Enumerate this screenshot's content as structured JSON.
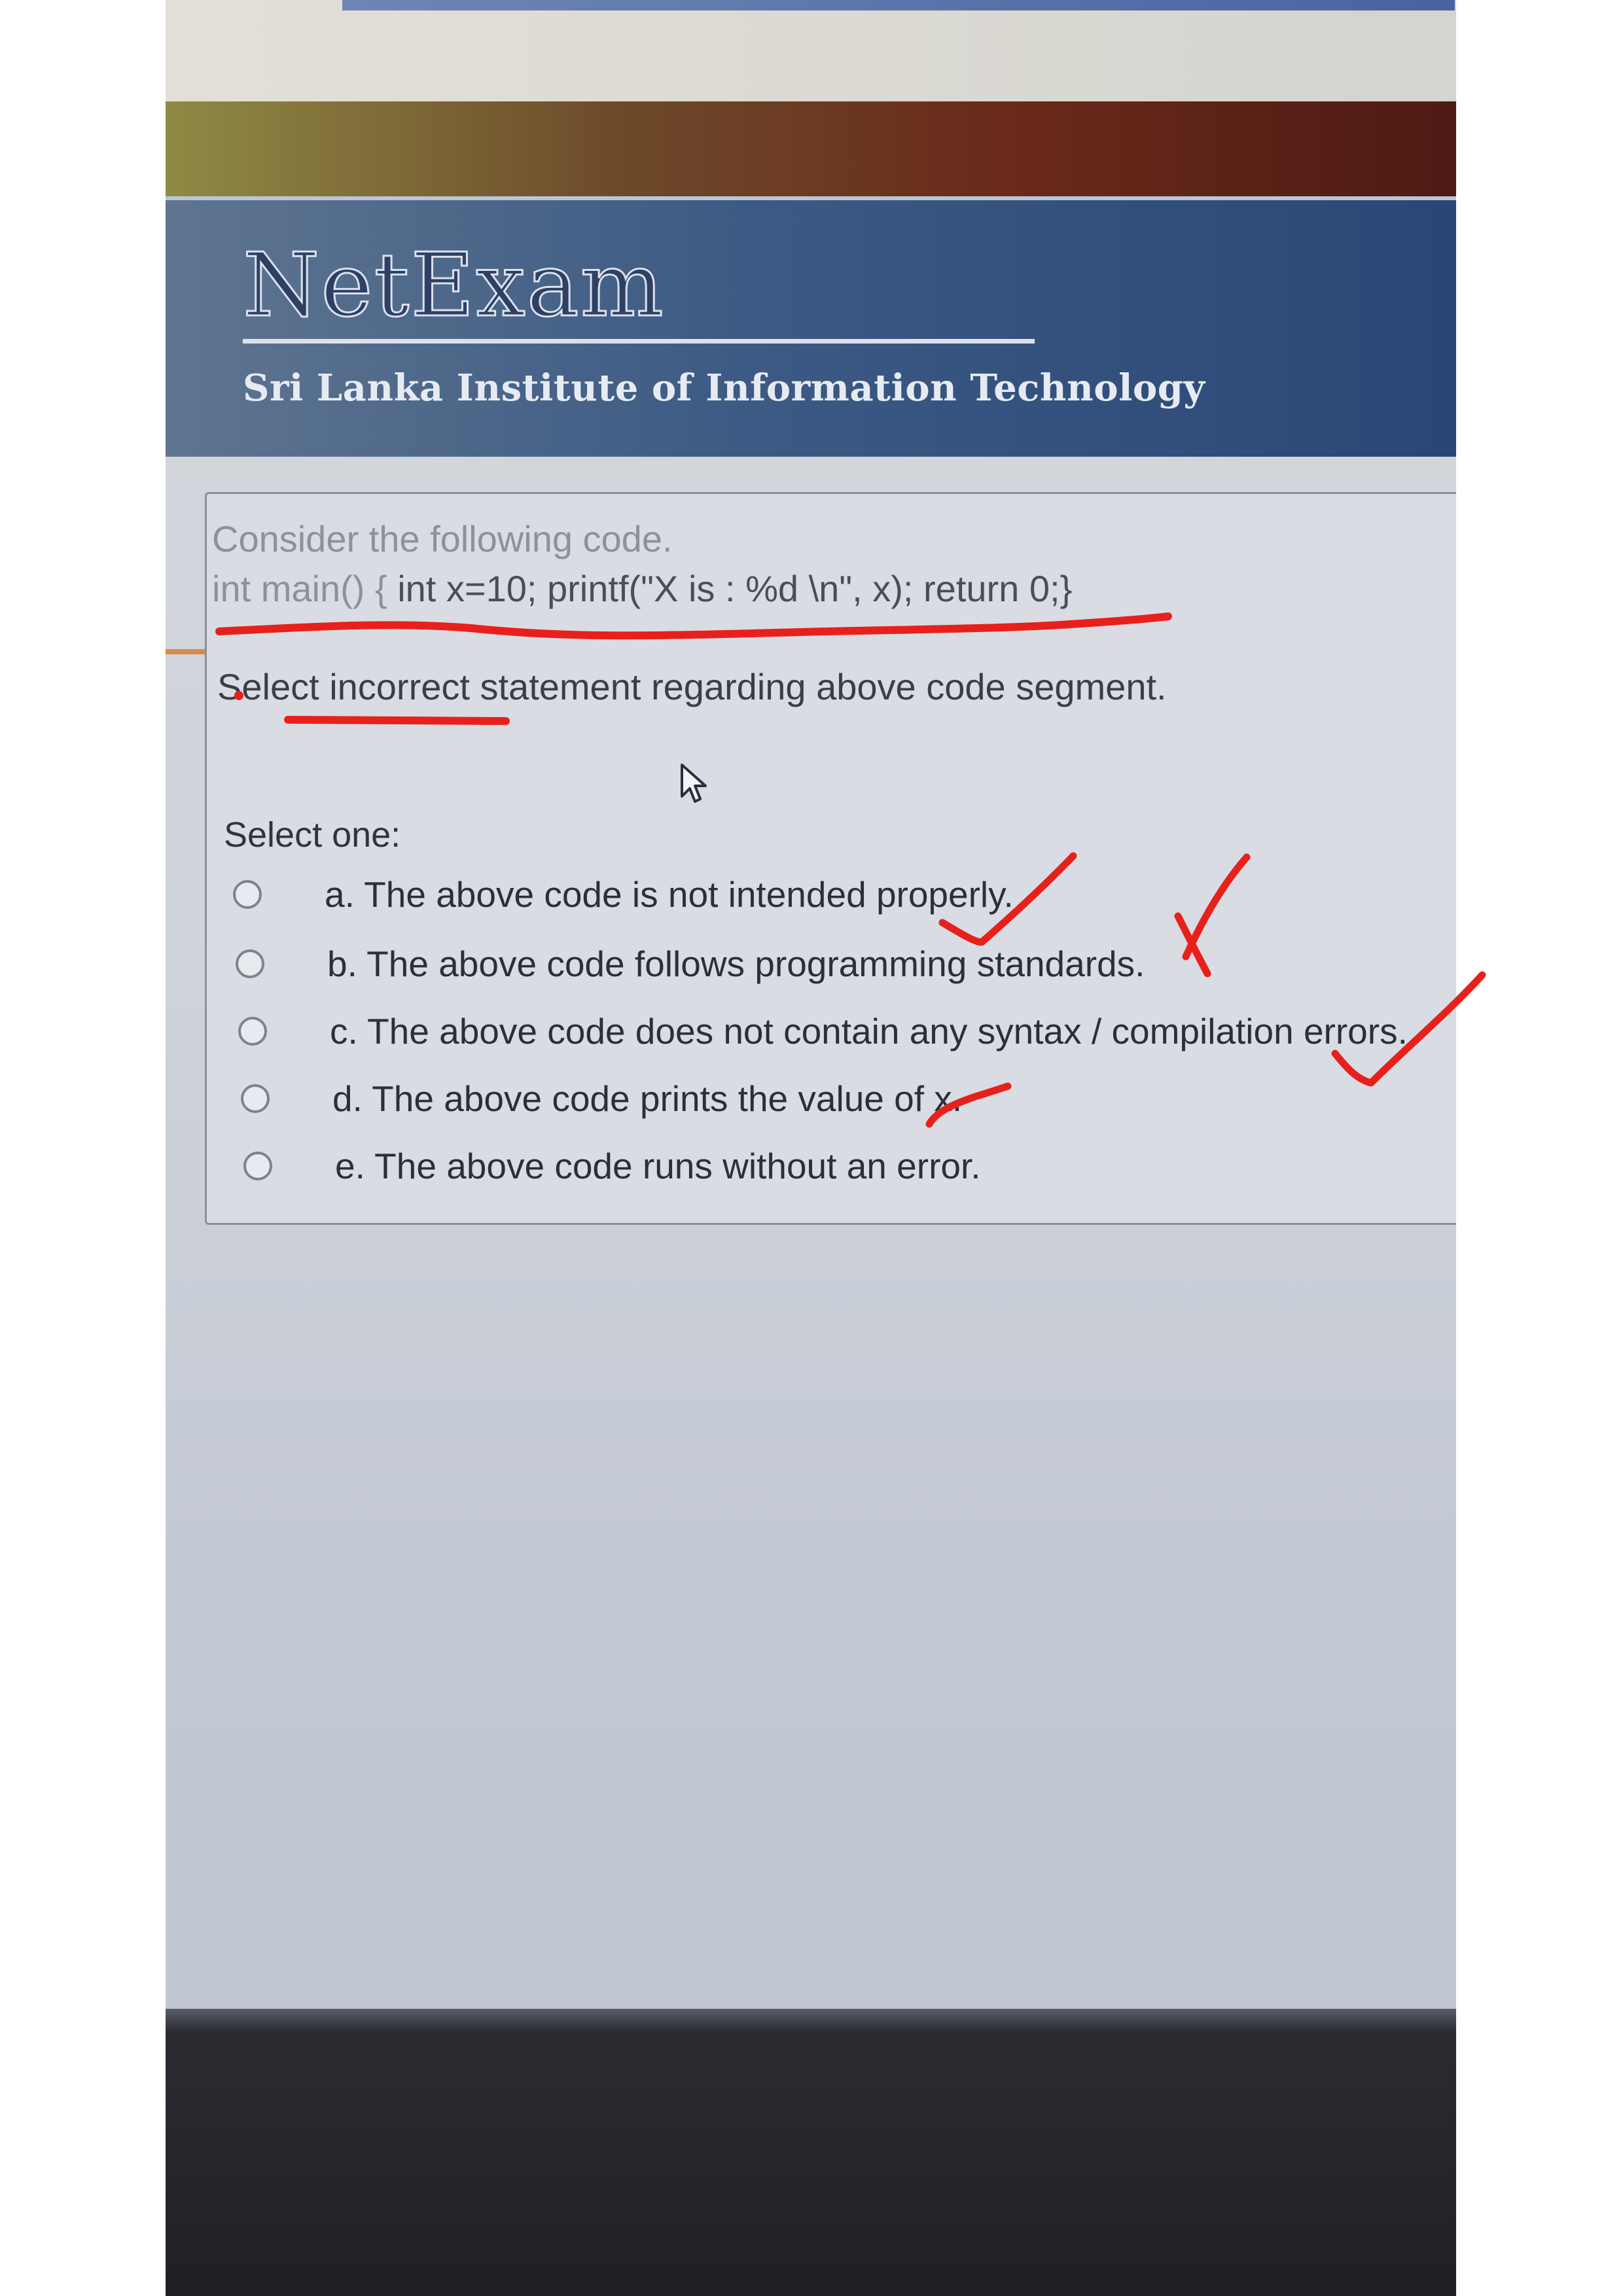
{
  "header": {
    "title": "NetExam",
    "subtitle": "Sri Lanka Institute of Information Technology"
  },
  "question": {
    "intro": "Consider the following code.",
    "code_start": "int main() { ",
    "code_rest": "int x=10; printf(\"X is : %d \\n\", x); return 0;}",
    "prompt": "Select incorrect statement regarding above code segment.",
    "select_label": "Select one:",
    "options": [
      {
        "label": "a. The above code is not intended properly."
      },
      {
        "label": "b. The above code follows programming standards."
      },
      {
        "label": "c. The above code does not contain any syntax / compilation errors."
      },
      {
        "label": "d. The above code prints the value of x."
      },
      {
        "label": "e. The above code runs without an error."
      }
    ]
  },
  "colors": {
    "annotation": "#e8201c",
    "banner": "#2a4676"
  },
  "icons": [
    "mouse-pointer-icon",
    "radio-icon",
    "checkmark-icon",
    "cross-icon"
  ]
}
